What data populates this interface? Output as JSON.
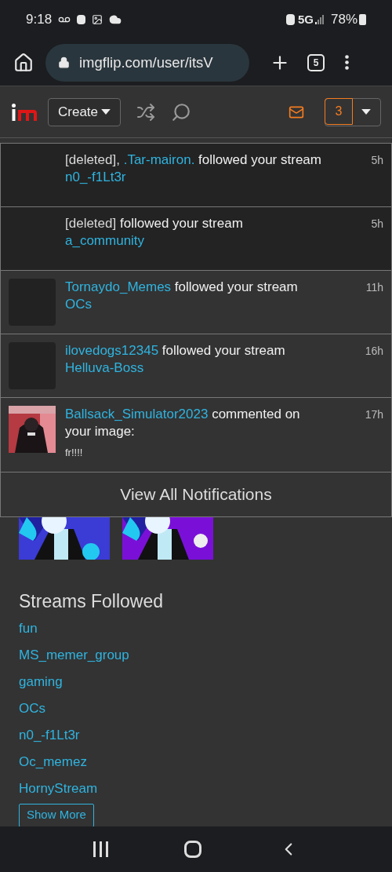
{
  "status_bar": {
    "time": "9:18",
    "network": "5G",
    "battery": "78%"
  },
  "browser": {
    "url": "imgflip.com/user/itsV",
    "tab_count": "5"
  },
  "nav": {
    "create_label": "Create",
    "notification_count": "3"
  },
  "notifications": {
    "items": [
      {
        "unread": true,
        "kind": "deleted",
        "time": "5h",
        "parts": [
          {
            "kind": "muted",
            "text": "[deleted],"
          },
          {
            "kind": "link",
            "text": ".Tar-mairon."
          },
          {
            "kind": "text",
            "text": "followed your stream"
          },
          {
            "kind": "link",
            "text": "n0_-f1Lt3r"
          }
        ]
      },
      {
        "unread": true,
        "kind": "deleted",
        "time": "5h",
        "parts": [
          {
            "kind": "muted",
            "text": "[deleted]"
          },
          {
            "kind": "text",
            "text": "followed your stream"
          },
          {
            "kind": "link",
            "text": "a_community"
          }
        ]
      },
      {
        "unread": false,
        "kind": "follow",
        "time": "11h",
        "parts": [
          {
            "kind": "link",
            "text": "Tornaydo_Memes"
          },
          {
            "kind": "text",
            "text": "followed your stream"
          },
          {
            "kind": "link",
            "text": "OCs"
          }
        ]
      },
      {
        "unread": false,
        "kind": "follow",
        "time": "16h",
        "parts": [
          {
            "kind": "link",
            "text": "ilovedogs12345"
          },
          {
            "kind": "text",
            "text": "followed your stream"
          },
          {
            "kind": "link",
            "text": "Helluva-Boss"
          }
        ]
      },
      {
        "unread": false,
        "kind": "comment",
        "time": "17h",
        "parts": [
          {
            "kind": "link",
            "text": "Ballsack_Simulator2023"
          },
          {
            "kind": "text",
            "text": "commented on your image:"
          }
        ],
        "comment": "fr!!!!"
      }
    ],
    "view_all": "View All Notifications"
  },
  "streams": {
    "title": "Streams Followed",
    "items": [
      "fun",
      "MS_memer_group",
      "gaming",
      "OCs",
      "n0_-f1Lt3r",
      "Oc_memez",
      "HornyStream"
    ],
    "show_more": "Show More"
  }
}
